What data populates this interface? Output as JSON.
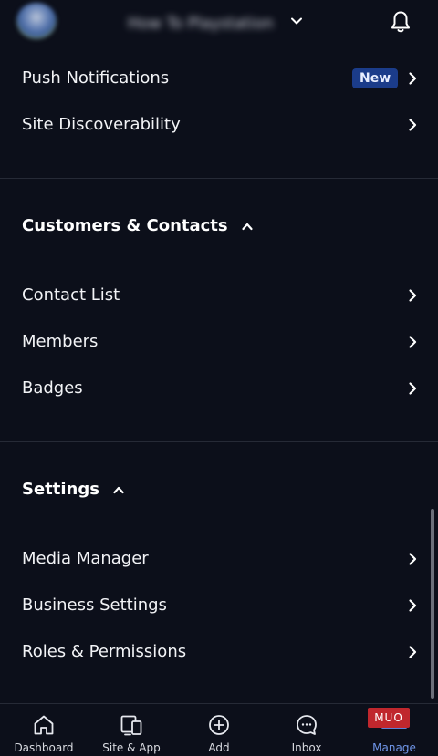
{
  "header": {
    "site_title": "How To Playstation"
  },
  "top_items": [
    {
      "label": "Push Notifications",
      "badge": "New"
    },
    {
      "label": "Site Discoverability"
    }
  ],
  "customers_section": {
    "title": "Customers & Contacts",
    "items": [
      {
        "label": "Contact List"
      },
      {
        "label": "Members"
      },
      {
        "label": "Badges"
      }
    ]
  },
  "settings_section": {
    "title": "Settings",
    "items": [
      {
        "label": "Media Manager"
      },
      {
        "label": "Business Settings"
      },
      {
        "label": "Roles & Permissions"
      }
    ]
  },
  "tabbar": {
    "tabs": [
      {
        "label": "Dashboard",
        "icon": "home-icon"
      },
      {
        "label": "Site & App",
        "icon": "devices-icon"
      },
      {
        "label": "Add",
        "icon": "add-circle-icon"
      },
      {
        "label": "Inbox",
        "icon": "chat-icon"
      },
      {
        "label": "Manage",
        "icon": "menu-icon",
        "active": true
      }
    ]
  },
  "watermark": "MUO",
  "colors": {
    "background": "#0c0f1a",
    "badge": "#1b3c8a",
    "active_tab": "#6f95e8",
    "divider": "#262a36"
  }
}
